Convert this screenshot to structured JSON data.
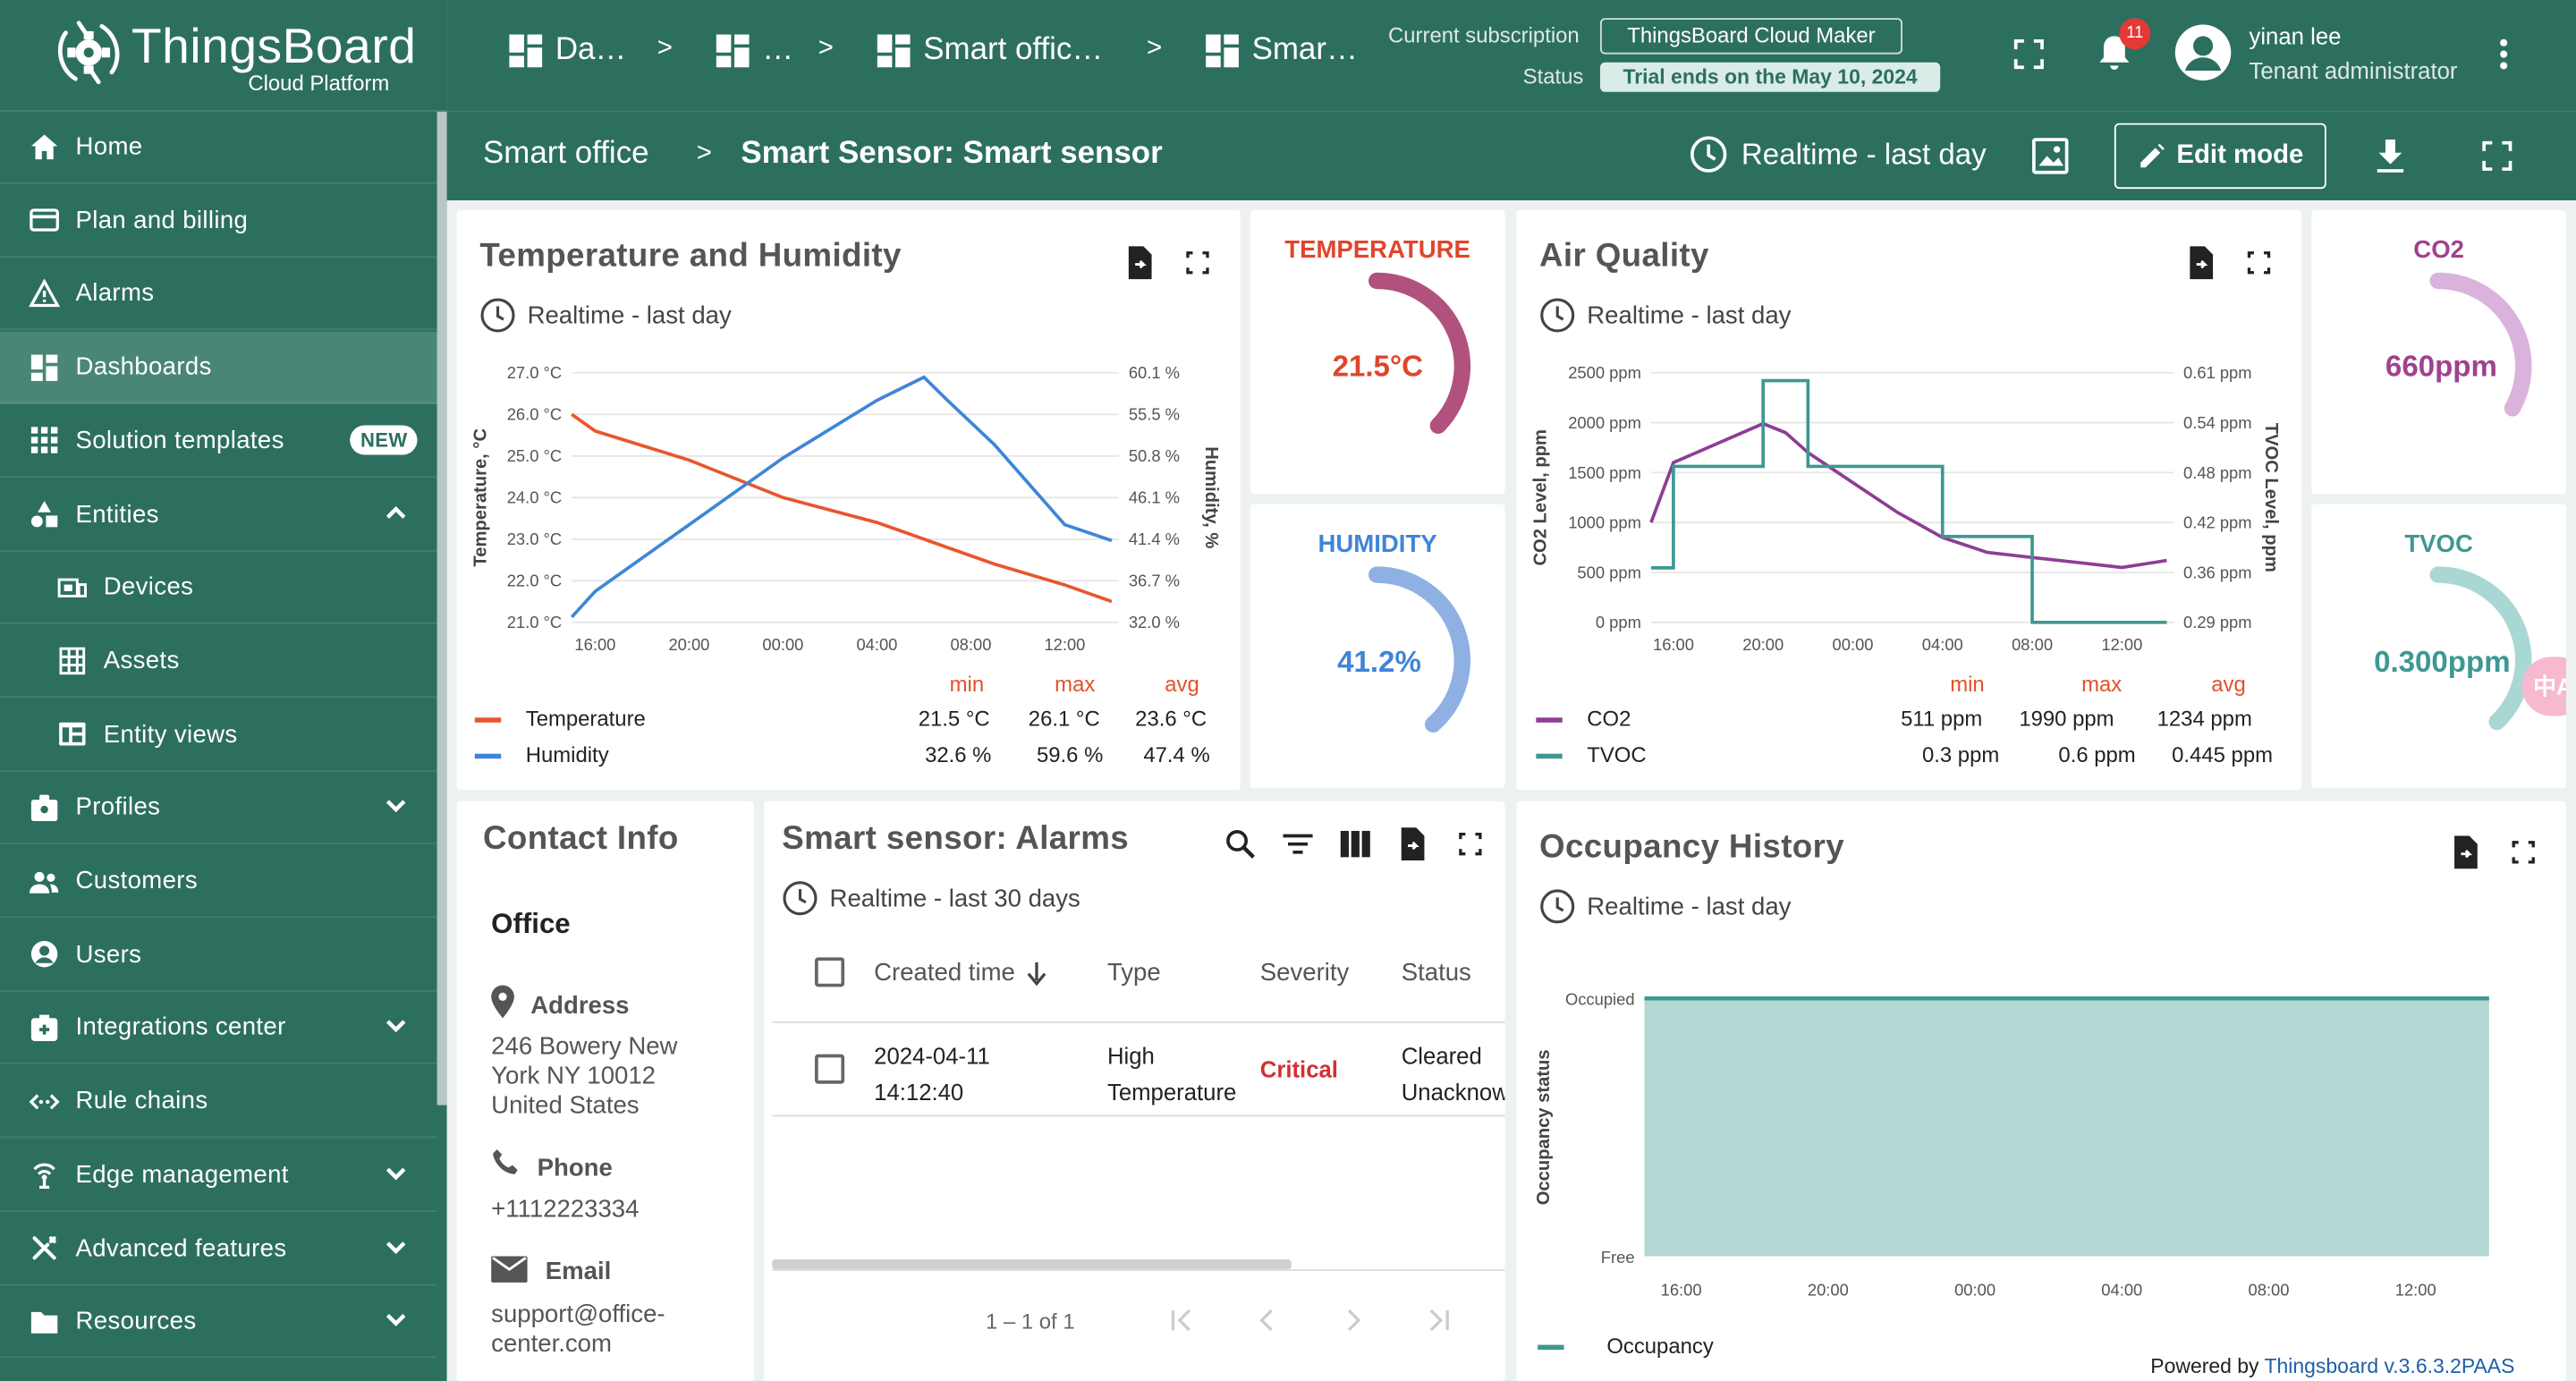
{
  "brand": {
    "name": "ThingsBoard",
    "sub": "Cloud Platform"
  },
  "breadcrumbs": [
    "Da…",
    "…",
    "Smart offic…",
    "Smar…"
  ],
  "subscription": {
    "label": "Current subscription",
    "plan": "ThingsBoard Cloud Maker",
    "status_label": "Status",
    "status": "Trial ends on the May 10, 2024"
  },
  "notifications": {
    "count": "11"
  },
  "user": {
    "name": "yinan lee",
    "role": "Tenant administrator"
  },
  "page": {
    "parent": "Smart office",
    "sep": ">",
    "title": "Smart Sensor: Smart sensor",
    "timewindow": "Realtime - last day",
    "edit_label": "Edit mode"
  },
  "sidebar": {
    "items": [
      {
        "label": "Home",
        "icon": "home-icon"
      },
      {
        "label": "Plan and billing",
        "icon": "billing-icon"
      },
      {
        "label": "Alarms",
        "icon": "alarm-icon"
      },
      {
        "label": "Dashboards",
        "icon": "dashboard-icon",
        "active": true
      },
      {
        "label": "Solution templates",
        "icon": "grid-icon",
        "badge": "NEW"
      },
      {
        "label": "Entities",
        "icon": "entities-icon",
        "expanded": true
      },
      {
        "label": "Devices",
        "icon": "devices-icon",
        "sub": true
      },
      {
        "label": "Assets",
        "icon": "assets-icon",
        "sub": true
      },
      {
        "label": "Entity views",
        "icon": "entity-views-icon",
        "sub": true
      },
      {
        "label": "Profiles",
        "icon": "profiles-icon",
        "collapsed": true
      },
      {
        "label": "Customers",
        "icon": "customers-icon"
      },
      {
        "label": "Users",
        "icon": "users-icon"
      },
      {
        "label": "Integrations center",
        "icon": "integrations-icon",
        "collapsed": true
      },
      {
        "label": "Rule chains",
        "icon": "rule-chains-icon"
      },
      {
        "label": "Edge management",
        "icon": "edge-icon",
        "collapsed": true
      },
      {
        "label": "Advanced features",
        "icon": "advanced-icon",
        "collapsed": true
      },
      {
        "label": "Resources",
        "icon": "resources-icon",
        "collapsed": true
      }
    ]
  },
  "temp_humidity": {
    "title": "Temperature and Humidity",
    "timewindow": "Realtime - last day",
    "left_axis_label": "Temperature, °C",
    "right_axis_label": "Humidity, %",
    "left_ticks": [
      "27.0 °C",
      "26.0 °C",
      "25.0 °C",
      "24.0 °C",
      "23.0 °C",
      "22.0 °C",
      "21.0 °C"
    ],
    "right_ticks": [
      "60.1 %",
      "55.5 %",
      "50.8 %",
      "46.1 %",
      "41.4 %",
      "36.7 %",
      "32.0 %"
    ],
    "x_ticks": [
      "16:00",
      "20:00",
      "00:00",
      "04:00",
      "08:00",
      "12:00"
    ],
    "legend_headers": [
      "min",
      "max",
      "avg"
    ],
    "legend": [
      {
        "name": "Temperature",
        "color": "#e8562c",
        "min": "21.5 °C",
        "max": "26.1 °C",
        "avg": "23.6 °C"
      },
      {
        "name": "Humidity",
        "color": "#3f85d8",
        "min": "32.6 %",
        "max": "59.6 %",
        "avg": "47.4 %"
      }
    ]
  },
  "gauges": {
    "temperature": {
      "title": "TEMPERATURE",
      "value": "21.5°C",
      "color": "#b0517e",
      "title_color": "#e0452c",
      "fraction": 0.52
    },
    "humidity": {
      "title": "HUMIDITY",
      "value": "41.2%",
      "color": "#8fb0e3",
      "title_color": "#3f85d8",
      "fraction": 0.58
    },
    "co2": {
      "title": "CO2",
      "value": "660ppm",
      "color": "#d9b3dc",
      "title_color": "#a0418f",
      "fraction": 0.33
    },
    "tvoc": {
      "title": "TVOC",
      "value": "0.300ppm",
      "color": "#a9d7d3",
      "title_color": "#3d9892",
      "fraction": 0.55
    }
  },
  "air_quality": {
    "title": "Air Quality",
    "timewindow": "Realtime - last day",
    "left_axis_label": "CO2 Level, ppm",
    "right_axis_label": "TVOC Level, ppm",
    "left_ticks": [
      "2500 ppm",
      "2000 ppm",
      "1500 ppm",
      "1000 ppm",
      "500 ppm",
      "0 ppm"
    ],
    "right_ticks": [
      "0.61 ppm",
      "0.54 ppm",
      "0.48 ppm",
      "0.42 ppm",
      "0.36 ppm",
      "0.29 ppm"
    ],
    "x_ticks": [
      "16:00",
      "20:00",
      "00:00",
      "04:00",
      "08:00",
      "12:00"
    ],
    "legend_headers": [
      "min",
      "max",
      "avg"
    ],
    "legend": [
      {
        "name": "CO2",
        "color": "#8e3d94",
        "min": "511 ppm",
        "max": "1990 ppm",
        "avg": "1234 ppm"
      },
      {
        "name": "TVOC",
        "color": "#3d9892",
        "min": "0.3 ppm",
        "max": "0.6 ppm",
        "avg": "0.445 ppm"
      }
    ]
  },
  "contact": {
    "title": "Contact Info",
    "office": "Office",
    "address_label": "Address",
    "address_lines": [
      "246 Bowery New",
      "York NY 10012",
      "United States"
    ],
    "phone_label": "Phone",
    "phone": "+1112223334",
    "email_label": "Email",
    "email_lines": [
      "support@office-",
      "center.com"
    ]
  },
  "alarms": {
    "title": "Smart sensor: Alarms",
    "timewindow": "Realtime - last 30 days",
    "columns": [
      "Created time",
      "Type",
      "Severity",
      "Status"
    ],
    "rows": [
      {
        "created": [
          "2024-04-11",
          "14:12:40"
        ],
        "type": [
          "High",
          "Temperature"
        ],
        "severity": "Critical",
        "status": [
          "Cleared",
          "Unacknow"
        ]
      }
    ],
    "pagination": "1 – 1 of 1"
  },
  "occupancy": {
    "title": "Occupancy History",
    "timewindow": "Realtime - last day",
    "y_axis_label": "Occupancy status",
    "y_ticks": [
      "Occupied",
      "Free"
    ],
    "x_ticks": [
      "16:00",
      "20:00",
      "00:00",
      "04:00",
      "08:00",
      "12:00"
    ],
    "legend": "Occupancy",
    "color": "#3d9892"
  },
  "footer": {
    "powered": "Powered by",
    "link": "Thingsboard v.3.6.3.2PAAS"
  },
  "chart_data": [
    {
      "type": "line",
      "title": "Temperature and Humidity",
      "x": [
        "15:00",
        "16:00",
        "20:00",
        "00:00",
        "04:00",
        "06:00",
        "07:00",
        "09:00",
        "12:00",
        "14:00"
      ],
      "x_ticks": [
        "16:00",
        "20:00",
        "00:00",
        "04:00",
        "08:00",
        "12:00"
      ],
      "ylabel": "Temperature, °C",
      "y2label": "Humidity, %",
      "ylim": [
        21.0,
        27.0
      ],
      "y2lim": [
        32.0,
        60.1
      ],
      "grid": true,
      "series": [
        {
          "name": "Temperature",
          "axis": "left",
          "color": "#e8562c",
          "values": [
            26.0,
            25.6,
            24.9,
            24.0,
            23.4,
            23.0,
            22.8,
            22.4,
            21.9,
            21.5
          ]
        },
        {
          "name": "Humidity",
          "axis": "right",
          "color": "#3f85d8",
          "values": [
            32.6,
            35.5,
            43.0,
            50.5,
            57.0,
            59.6,
            57.0,
            52.0,
            43.0,
            41.2
          ]
        }
      ]
    },
    {
      "type": "line",
      "title": "Air Quality",
      "x": [
        "15:00",
        "16:00",
        "20:00",
        "21:00",
        "22:00",
        "00:00",
        "02:00",
        "04:00",
        "06:00",
        "08:00",
        "10:00",
        "12:00",
        "14:00"
      ],
      "x_ticks": [
        "16:00",
        "20:00",
        "00:00",
        "04:00",
        "08:00",
        "12:00"
      ],
      "ylabel": "CO2 Level, ppm",
      "y2label": "TVOC Level, ppm",
      "ylim": [
        0,
        2500
      ],
      "y2lim": [
        0.29,
        0.61
      ],
      "grid": true,
      "series": [
        {
          "name": "CO2",
          "axis": "left",
          "color": "#8e3d94",
          "values": [
            1000,
            1600,
            1990,
            1900,
            1700,
            1400,
            1100,
            850,
            700,
            650,
            600,
            550,
            620
          ]
        },
        {
          "name": "TVOC",
          "axis": "right",
          "color": "#3d9892",
          "values": [
            0.36,
            0.49,
            0.6,
            0.6,
            0.49,
            0.49,
            0.49,
            0.4,
            0.4,
            0.29,
            0.29,
            0.29,
            0.29
          ]
        }
      ]
    },
    {
      "type": "area",
      "title": "Occupancy History",
      "x": [
        "15:00",
        "16:00",
        "20:00",
        "00:00",
        "04:00",
        "08:00",
        "12:00",
        "14:00"
      ],
      "x_ticks": [
        "16:00",
        "20:00",
        "00:00",
        "04:00",
        "08:00",
        "12:00"
      ],
      "ylabel": "Occupancy status",
      "y_categories": [
        "Free",
        "Occupied"
      ],
      "series": [
        {
          "name": "Occupancy",
          "color": "#3d9892",
          "values": [
            1,
            1,
            1,
            1,
            1,
            1,
            1,
            1
          ]
        }
      ]
    }
  ]
}
